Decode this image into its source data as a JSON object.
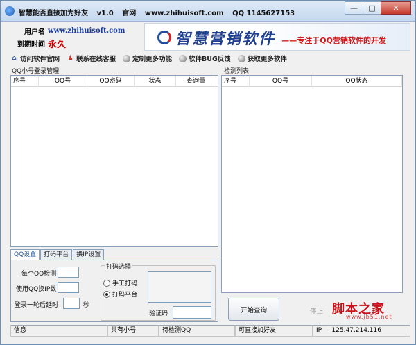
{
  "titlebar": {
    "app_name": "智慧能否直接加为好友",
    "version": "v1.0",
    "site_label": "官网",
    "site_url": "www.zhihuisoft.com",
    "qq_label": "QQ 1145627153",
    "minimize_glyph": "—",
    "maximize_glyph": "□",
    "close_glyph": "✕"
  },
  "info": {
    "username_label": "用户名",
    "username_value": "www.zhihuisoft.com",
    "expire_label": "到期时间",
    "expire_value": "永久"
  },
  "banner": {
    "name": "智慧营销软件",
    "slogan": "——专注于QQ营销软件的开发"
  },
  "menu": {
    "items": [
      {
        "label": "访问软件官网",
        "icon": "home-icon"
      },
      {
        "label": "联系在线客服",
        "icon": "person-icon"
      },
      {
        "label": "定制更多功能",
        "icon": "dot-icon"
      },
      {
        "label": "软件BUG反馈",
        "icon": "dot-icon"
      },
      {
        "label": "获取更多软件",
        "icon": "dot-icon"
      }
    ]
  },
  "login_panel": {
    "title": "QQ小号登录管理",
    "columns": [
      "序号",
      "QQ号",
      "QQ密码",
      "状态",
      "查询量"
    ]
  },
  "detect_panel": {
    "title": "检测列表",
    "columns": [
      "序号",
      "QQ号",
      "QQ状态"
    ]
  },
  "tabs": [
    {
      "label": "QQ设置",
      "active": true
    },
    {
      "label": "打码平台",
      "active": false
    },
    {
      "label": "换IP设置",
      "active": false
    }
  ],
  "qq_settings": {
    "check_each_label": "每个QQ检测",
    "switch_ip_label": "使用QQ换IP数",
    "delay_label": "登录一轮后延时",
    "delay_unit": "秒"
  },
  "captcha": {
    "group_title": "打码选择",
    "manual_label": "手工打码",
    "platform_label": "打码平台",
    "selected": "打码平台",
    "code_label": "验证码"
  },
  "actions": {
    "start_label": "开始查询",
    "stop_label": "停止"
  },
  "watermark": {
    "text": "脚本之家",
    "url": "www.jb51.net"
  },
  "statusbar": {
    "info_label": "信息",
    "total_label": "共有小号",
    "pending_label": "待检测QQ",
    "addable_label": "可直接加好友",
    "ip_label": "IP",
    "ip_value": "125.47.214.116"
  }
}
